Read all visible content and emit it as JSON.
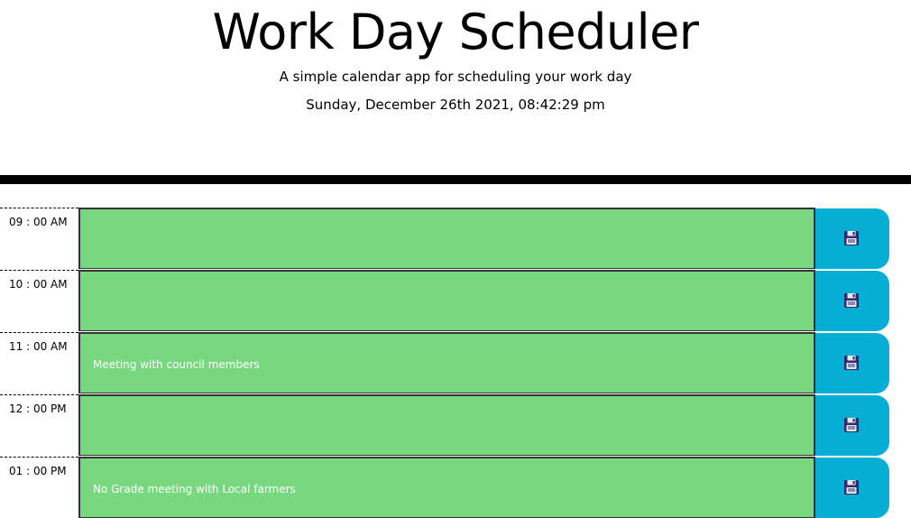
{
  "header": {
    "title": "Work Day Scheduler",
    "lead": "A simple calendar app for scheduling your work day",
    "current_day": "Sunday, December 26th 2021, 08:42:29 pm"
  },
  "colors": {
    "present_future_block": "#77d880",
    "save_button": "#06aed5",
    "icon": "#2c2c6e"
  },
  "time_blocks": [
    {
      "hour": "09 : 00 AM",
      "description": "",
      "save_icon": "floppy-disk-icon"
    },
    {
      "hour": "10 : 00 AM",
      "description": "",
      "save_icon": "floppy-disk-icon"
    },
    {
      "hour": "11 : 00 AM",
      "description": "Meeting with council members",
      "save_icon": "floppy-disk-icon"
    },
    {
      "hour": "12 : 00 PM",
      "description": "",
      "save_icon": "floppy-disk-icon"
    },
    {
      "hour": "01 : 00 PM",
      "description": "No Grade meeting with Local farmers",
      "save_icon": "floppy-disk-icon"
    }
  ]
}
